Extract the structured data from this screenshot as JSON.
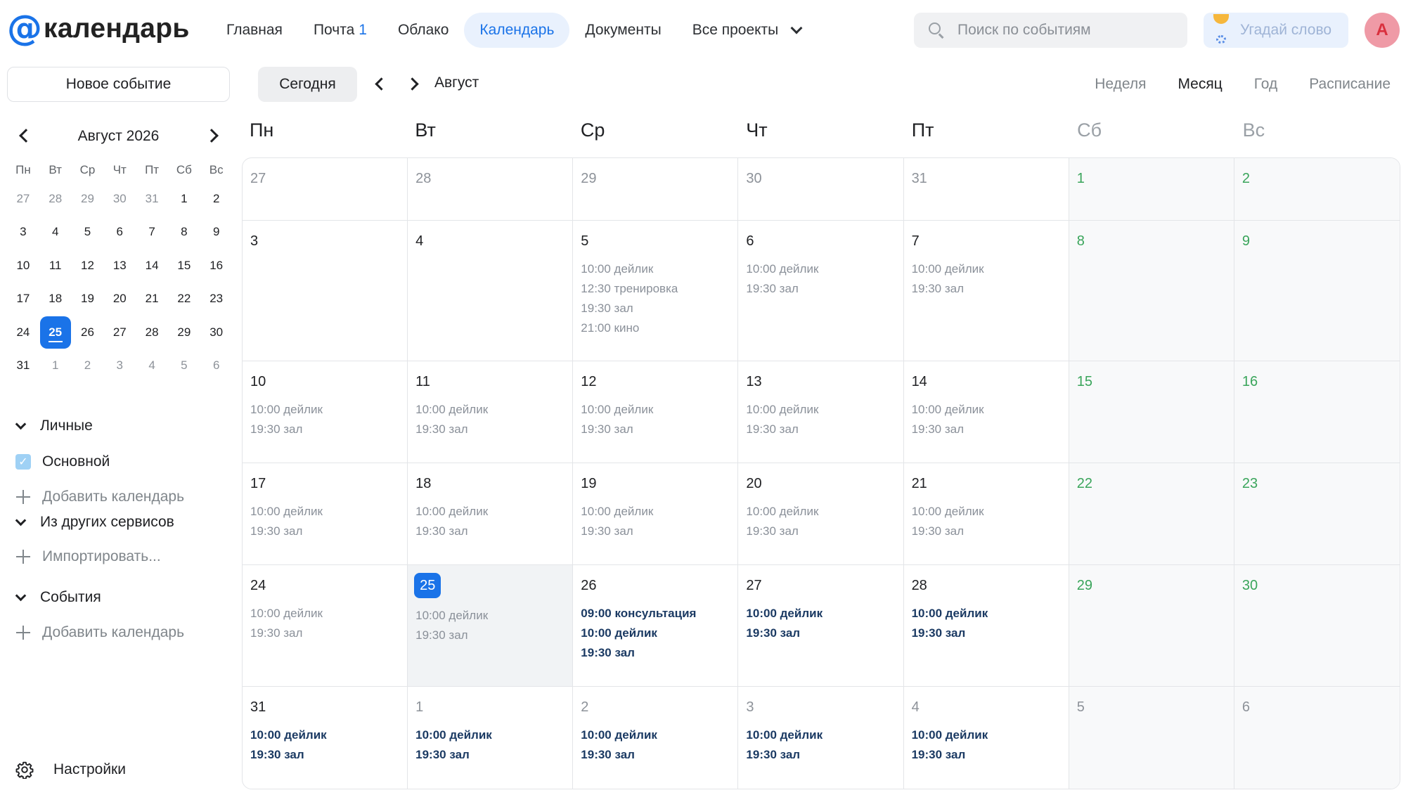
{
  "header": {
    "logo_at": "@",
    "logo_text": "календарь",
    "nav": [
      {
        "label": "Главная",
        "badge": ""
      },
      {
        "label": "Почта",
        "badge": "1"
      },
      {
        "label": "Облако",
        "badge": ""
      },
      {
        "label": "Календарь",
        "badge": "",
        "active": true
      },
      {
        "label": "Документы",
        "badge": ""
      },
      {
        "label": "Все проекты",
        "badge": "",
        "dropdown": true
      }
    ],
    "search_placeholder": "Поиск по событиям",
    "promo_label": "Угадай слово",
    "avatar_letter": "А"
  },
  "sidebar": {
    "new_event": "Новое событие",
    "mini_calendar": {
      "title": "Август 2026",
      "weekdays": [
        "Пн",
        "Вт",
        "Ср",
        "Чт",
        "Пт",
        "Сб",
        "Вс"
      ],
      "weeks": [
        [
          {
            "d": "27",
            "o": true
          },
          {
            "d": "28",
            "o": true
          },
          {
            "d": "29",
            "o": true
          },
          {
            "d": "30",
            "o": true
          },
          {
            "d": "31",
            "o": true
          },
          {
            "d": "1"
          },
          {
            "d": "2"
          }
        ],
        [
          {
            "d": "3"
          },
          {
            "d": "4"
          },
          {
            "d": "5"
          },
          {
            "d": "6"
          },
          {
            "d": "7"
          },
          {
            "d": "8"
          },
          {
            "d": "9"
          }
        ],
        [
          {
            "d": "10"
          },
          {
            "d": "11"
          },
          {
            "d": "12"
          },
          {
            "d": "13"
          },
          {
            "d": "14"
          },
          {
            "d": "15"
          },
          {
            "d": "16"
          }
        ],
        [
          {
            "d": "17"
          },
          {
            "d": "18"
          },
          {
            "d": "19"
          },
          {
            "d": "20"
          },
          {
            "d": "21"
          },
          {
            "d": "22"
          },
          {
            "d": "23"
          }
        ],
        [
          {
            "d": "24"
          },
          {
            "d": "25",
            "today": true
          },
          {
            "d": "26"
          },
          {
            "d": "27"
          },
          {
            "d": "28"
          },
          {
            "d": "29"
          },
          {
            "d": "30"
          }
        ],
        [
          {
            "d": "31"
          },
          {
            "d": "1",
            "o": true
          },
          {
            "d": "2",
            "o": true
          },
          {
            "d": "3",
            "o": true
          },
          {
            "d": "4",
            "o": true
          },
          {
            "d": "5",
            "o": true
          },
          {
            "d": "6",
            "o": true
          }
        ]
      ]
    },
    "personal": {
      "label": "Личные",
      "calendar": "Основной",
      "add": "Добавить календарь"
    },
    "other_services": {
      "label": "Из других сервисов",
      "import": "Импортировать..."
    },
    "events": {
      "label": "События",
      "add": "Добавить календарь"
    },
    "settings": "Настройки"
  },
  "toolbar": {
    "today": "Сегодня",
    "month": "Август",
    "views": [
      {
        "label": "Неделя"
      },
      {
        "label": "Месяц",
        "active": true
      },
      {
        "label": "Год"
      },
      {
        "label": "Расписание"
      }
    ]
  },
  "month_view": {
    "weekdays": [
      "Пн",
      "Вт",
      "Ср",
      "Чт",
      "Пт",
      "Сб",
      "Вс"
    ],
    "weeks": [
      [
        {
          "day": "27",
          "muted": true,
          "events": []
        },
        {
          "day": "28",
          "muted": true,
          "events": []
        },
        {
          "day": "29",
          "muted": true,
          "events": []
        },
        {
          "day": "30",
          "muted": true,
          "events": []
        },
        {
          "day": "31",
          "muted": true,
          "events": []
        },
        {
          "day": "1",
          "weekend": true,
          "events": []
        },
        {
          "day": "2",
          "weekend": true,
          "events": []
        }
      ],
      [
        {
          "day": "3",
          "events": []
        },
        {
          "day": "4",
          "events": []
        },
        {
          "day": "5",
          "events": [
            "10:00 дейлик",
            "12:30 тренировка",
            "19:30 зал",
            "21:00 кино"
          ]
        },
        {
          "day": "6",
          "events": [
            "10:00 дейлик",
            "19:30 зал"
          ]
        },
        {
          "day": "7",
          "events": [
            "10:00 дейлик",
            "19:30 зал"
          ]
        },
        {
          "day": "8",
          "weekend": true,
          "events": []
        },
        {
          "day": "9",
          "weekend": true,
          "events": []
        }
      ],
      [
        {
          "day": "10",
          "events": [
            "10:00 дейлик",
            "19:30 зал"
          ]
        },
        {
          "day": "11",
          "events": [
            "10:00 дейлик",
            "19:30 зал"
          ]
        },
        {
          "day": "12",
          "events": [
            "10:00 дейлик",
            "19:30 зал"
          ]
        },
        {
          "day": "13",
          "events": [
            "10:00 дейлик",
            "19:30 зал"
          ]
        },
        {
          "day": "14",
          "events": [
            "10:00 дейлик",
            "19:30 зал"
          ]
        },
        {
          "day": "15",
          "weekend": true,
          "events": []
        },
        {
          "day": "16",
          "weekend": true,
          "events": []
        }
      ],
      [
        {
          "day": "17",
          "events": [
            "10:00 дейлик",
            "19:30 зал"
          ]
        },
        {
          "day": "18",
          "events": [
            "10:00 дейлик",
            "19:30 зал"
          ]
        },
        {
          "day": "19",
          "events": [
            "10:00 дейлик",
            "19:30 зал"
          ]
        },
        {
          "day": "20",
          "events": [
            "10:00 дейлик",
            "19:30 зал"
          ]
        },
        {
          "day": "21",
          "events": [
            "10:00 дейлик",
            "19:30 зал"
          ]
        },
        {
          "day": "22",
          "weekend": true,
          "events": []
        },
        {
          "day": "23",
          "weekend": true,
          "events": []
        }
      ],
      [
        {
          "day": "24",
          "events": [
            "10:00 дейлик",
            "19:30 зал"
          ]
        },
        {
          "day": "25",
          "today": true,
          "events": [
            "10:00 дейлик",
            "19:30 зал"
          ]
        },
        {
          "day": "26",
          "future": true,
          "events": [
            "09:00 консультация",
            "10:00 дейлик",
            "19:30 зал"
          ]
        },
        {
          "day": "27",
          "future": true,
          "events": [
            "10:00 дейлик",
            "19:30 зал"
          ]
        },
        {
          "day": "28",
          "future": true,
          "events": [
            "10:00 дейлик",
            "19:30 зал"
          ]
        },
        {
          "day": "29",
          "weekend": true,
          "events": []
        },
        {
          "day": "30",
          "weekend": true,
          "events": []
        }
      ],
      [
        {
          "day": "31",
          "future": true,
          "events": [
            "10:00 дейлик",
            "19:30 зал"
          ]
        },
        {
          "day": "1",
          "muted": true,
          "future": true,
          "events": [
            "10:00 дейлик",
            "19:30 зал"
          ]
        },
        {
          "day": "2",
          "muted": true,
          "future": true,
          "events": [
            "10:00 дейлик",
            "19:30 зал"
          ]
        },
        {
          "day": "3",
          "muted": true,
          "future": true,
          "events": [
            "10:00 дейлик",
            "19:30 зал"
          ]
        },
        {
          "day": "4",
          "muted": true,
          "future": true,
          "events": [
            "10:00 дейлик",
            "19:30 зал"
          ]
        },
        {
          "day": "5",
          "muted": true,
          "events": []
        },
        {
          "day": "6",
          "muted": true,
          "events": []
        }
      ]
    ]
  },
  "colors": {
    "accent": "#1a73e8",
    "weekend_day": "#3aa55b",
    "past_event": "#8a9099",
    "upcoming_event": "#1b3a63",
    "avatar_bg": "#ef9aa6"
  }
}
